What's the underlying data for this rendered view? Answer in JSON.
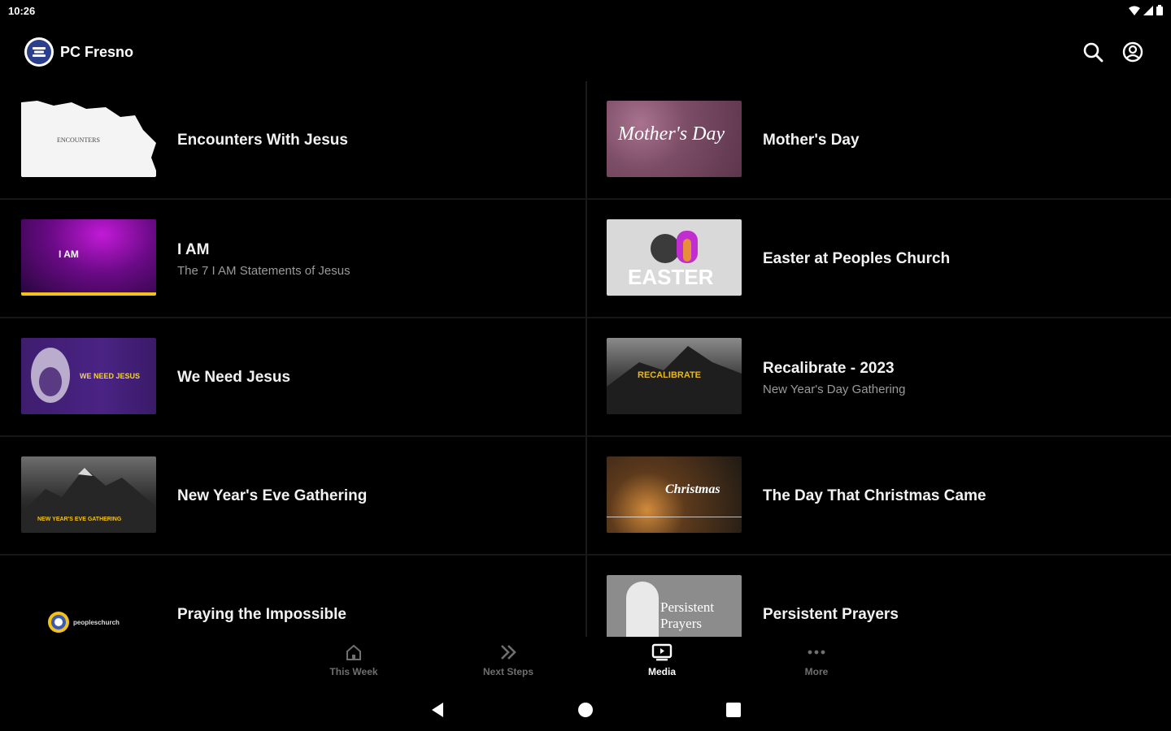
{
  "status": {
    "time": "10:26"
  },
  "app": {
    "title": "PC Fresno"
  },
  "toolbar": {
    "search_icon": "search-icon",
    "account_icon": "account-circle-icon"
  },
  "media": {
    "left": [
      {
        "title": "Encounters With Jesus",
        "subtitle": "",
        "thumb_text": "ENCOUNTERS"
      },
      {
        "title": "I AM",
        "subtitle": "The 7 I AM Statements of Jesus",
        "thumb_text": "I AM"
      },
      {
        "title": "We Need Jesus",
        "subtitle": "",
        "thumb_text": "WE NEED JESUS"
      },
      {
        "title": "New Year's Eve Gathering",
        "subtitle": "",
        "thumb_text": "NEW YEAR'S EVE GATHERING"
      },
      {
        "title": "Praying the Impossible",
        "subtitle": "",
        "thumb_text": "peopleschurch"
      }
    ],
    "right": [
      {
        "title": "Mother's Day",
        "subtitle": "",
        "thumb_text": "Mother's Day"
      },
      {
        "title": "Easter at Peoples Church",
        "subtitle": "",
        "thumb_text": "EASTER"
      },
      {
        "title": "Recalibrate - 2023",
        "subtitle": "New Year's Day Gathering",
        "thumb_text": "RECALIBRATE"
      },
      {
        "title": "The Day That Christmas Came",
        "subtitle": "",
        "thumb_text": "Christmas"
      },
      {
        "title": "Persistent Prayers",
        "subtitle": "",
        "thumb_text": "Persistent Prayers"
      }
    ]
  },
  "nav": [
    {
      "label": "This Week",
      "icon": "home-icon"
    },
    {
      "label": "Next Steps",
      "icon": "double-chevron-icon"
    },
    {
      "label": "Media",
      "icon": "media-icon"
    },
    {
      "label": "More",
      "icon": "more-dots-icon"
    }
  ],
  "colors": {
    "background": "#000000",
    "inactive": "#6f6f6f",
    "active": "#ffffff",
    "subtitle": "#9a9a9a"
  }
}
